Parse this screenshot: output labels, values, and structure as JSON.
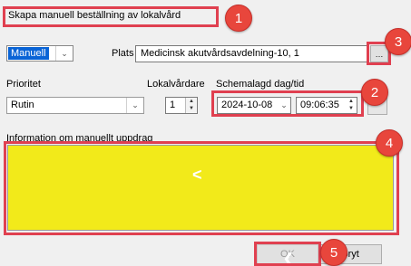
{
  "window": {
    "title": "Skapa manuell beställning av lokalvård"
  },
  "order_type": {
    "value": "Manuell"
  },
  "location": {
    "label": "Plats",
    "value": "Medicinsk akutvårdsavdelning-10, 1"
  },
  "priority": {
    "label": "Prioritet",
    "value": "Rutin"
  },
  "cleaners": {
    "label": "Lokalvårdare",
    "value": "1"
  },
  "schedule": {
    "label": "Schemalagd dag/tid",
    "date": "2024-10-08",
    "time": "09:06:35"
  },
  "info": {
    "label": "Information om manuellt uppdrag",
    "cursor_glyph": "<"
  },
  "buttons": {
    "ok": "OK",
    "cancel": "Avbryt",
    "cancel_visible": "vbryt"
  },
  "callouts": [
    "1",
    "2",
    "3",
    "4",
    "5"
  ],
  "colors": {
    "callout": "#e04050",
    "badge": "#e8463c",
    "info_bg": "#f2ea1a",
    "selected": "#0a64d6"
  }
}
